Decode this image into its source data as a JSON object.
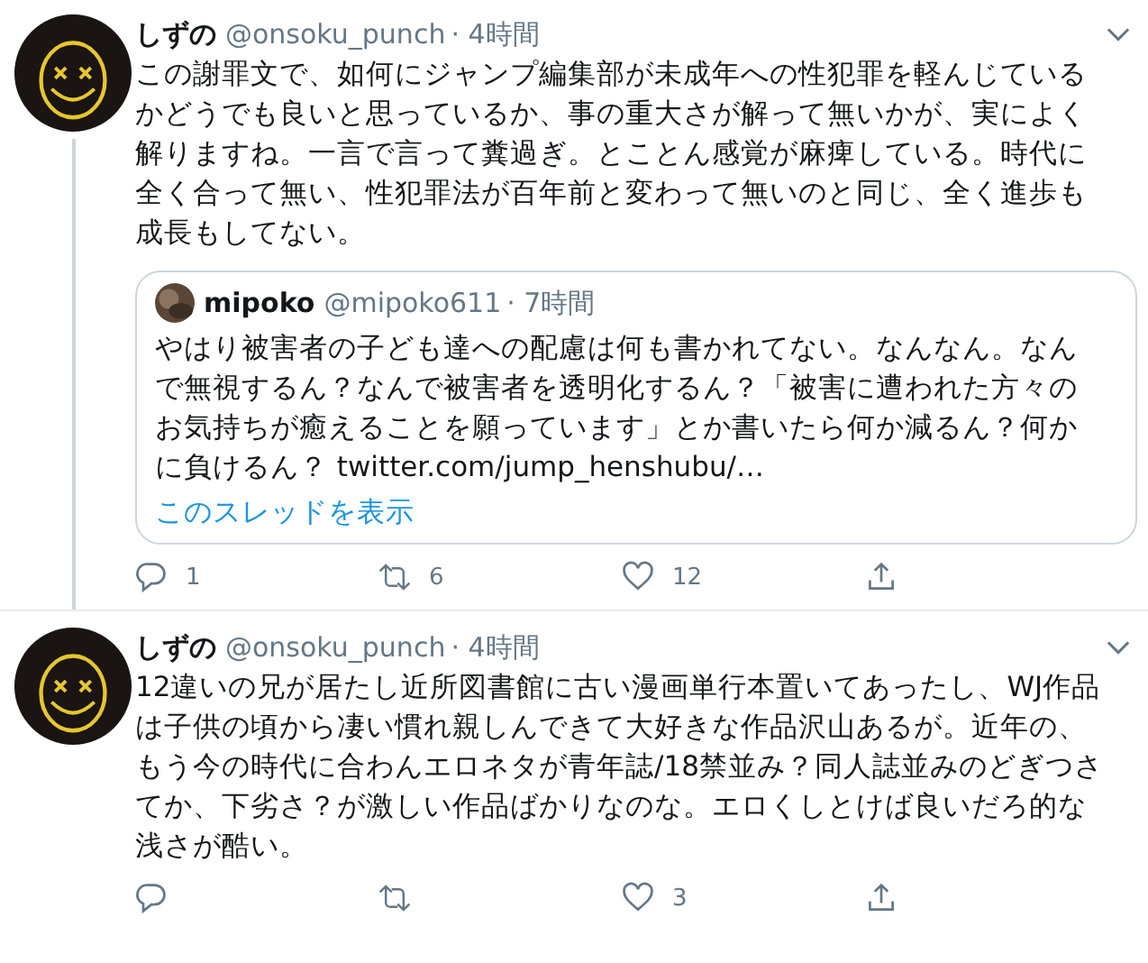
{
  "tweets": [
    {
      "name": "しずの",
      "handle": "@onsoku_punch",
      "time": "· 4時間",
      "thread_line": true,
      "text": "この謝罪文で、如何にジャンプ編集部が未成年への性犯罪を軽んじているかどうでも良いと思っているか、事の重大さが解って無いかが、実によく解りますね。一言で言って糞過ぎ。とことん感覚が麻痺している。時代に全く合って無い、性犯罪法が百年前と変わって無いのと同じ、全く進歩も成長もしてない。",
      "quote": {
        "name": "mipoko",
        "handle": "@mipoko611",
        "time": "· 7時間",
        "text": "やはり被害者の子ども達への配慮は何も書かれてない。なんなん。なんで無視するん？なんで被害者を透明化するん？「被害に遭われた方々のお気持ちが癒えることを願っています」とか書いたら何か減るん？何かに負けるん？ twitter.com/jump_henshubu/…",
        "link": "このスレッドを表示"
      },
      "actions": {
        "reply": "1",
        "retweet": "6",
        "like": "12"
      }
    },
    {
      "name": "しずの",
      "handle": "@onsoku_punch",
      "time": "· 4時間",
      "thread_line": false,
      "text": "12違いの兄が居たし近所図書館に古い漫画単行本置いてあったし、WJ作品は子供の頃から凄い慣れ親しんできて大好きな作品沢山あるが。近年の、もう今の時代に合わんエロネタが青年誌/18禁並み？同人誌並みのどぎつさてか、下劣さ？が激しい作品ばかりなのな。エロくしとけば良いだろ的な浅さが酷い。",
      "actions": {
        "like": "3"
      }
    }
  ]
}
